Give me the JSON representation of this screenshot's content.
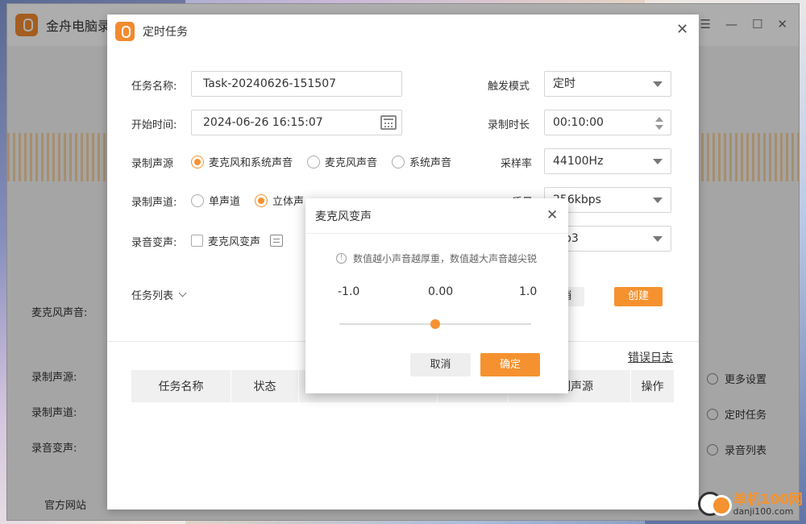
{
  "app": {
    "title": "金舟电脑录",
    "controls": [
      "☰",
      "—",
      "☐",
      "✕"
    ],
    "left_labels": [
      "麦克风声音:",
      "录制声源:",
      "录制声道:",
      "录音变声:"
    ],
    "right_menu": [
      "更多设置",
      "定时任务",
      "录音列表"
    ],
    "bottom": [
      "官方网站"
    ]
  },
  "task_dialog": {
    "title": "定时任务",
    "task_name_label": "任务名称:",
    "task_name_value": "Task-20240626-151507",
    "start_time_label": "开始时间:",
    "start_time_value": "2024-06-26  16:15:07",
    "source_label": "录制声源",
    "source_options": [
      "麦克风和系统声音",
      "麦克风声音",
      "系统声音"
    ],
    "channel_label": "录制声道:",
    "channel_options": [
      "单声道",
      "立体声"
    ],
    "voice_change_label": "录音变声:",
    "voice_change_checkbox": "麦克风变声",
    "trigger_label": "触发模式",
    "trigger_value": "定时",
    "duration_label": "录制时长",
    "duration_value": "00:10:00",
    "sample_label": "采样率",
    "sample_value": "44100Hz",
    "quality_label": "质量",
    "quality_value": "256kbps",
    "format_value": "p3",
    "task_list_label": "任务列表",
    "cancel_btn": "消",
    "create_btn": "创建",
    "error_log": "错误日志",
    "columns": [
      "任务名称",
      "状态",
      "",
      "",
      "制声源",
      "操作"
    ]
  },
  "voice_dialog": {
    "title": "麦克风变声",
    "hint": "数值越小声音越厚重，数值越大声音越尖锐",
    "min": "-1.0",
    "mid": "0.00",
    "max": "1.0",
    "value": 0.0,
    "cancel": "取消",
    "ok": "确定"
  },
  "watermark": {
    "site": "单机100网",
    "url": "danji100.com"
  },
  "colors": {
    "accent": "#f5922f"
  }
}
